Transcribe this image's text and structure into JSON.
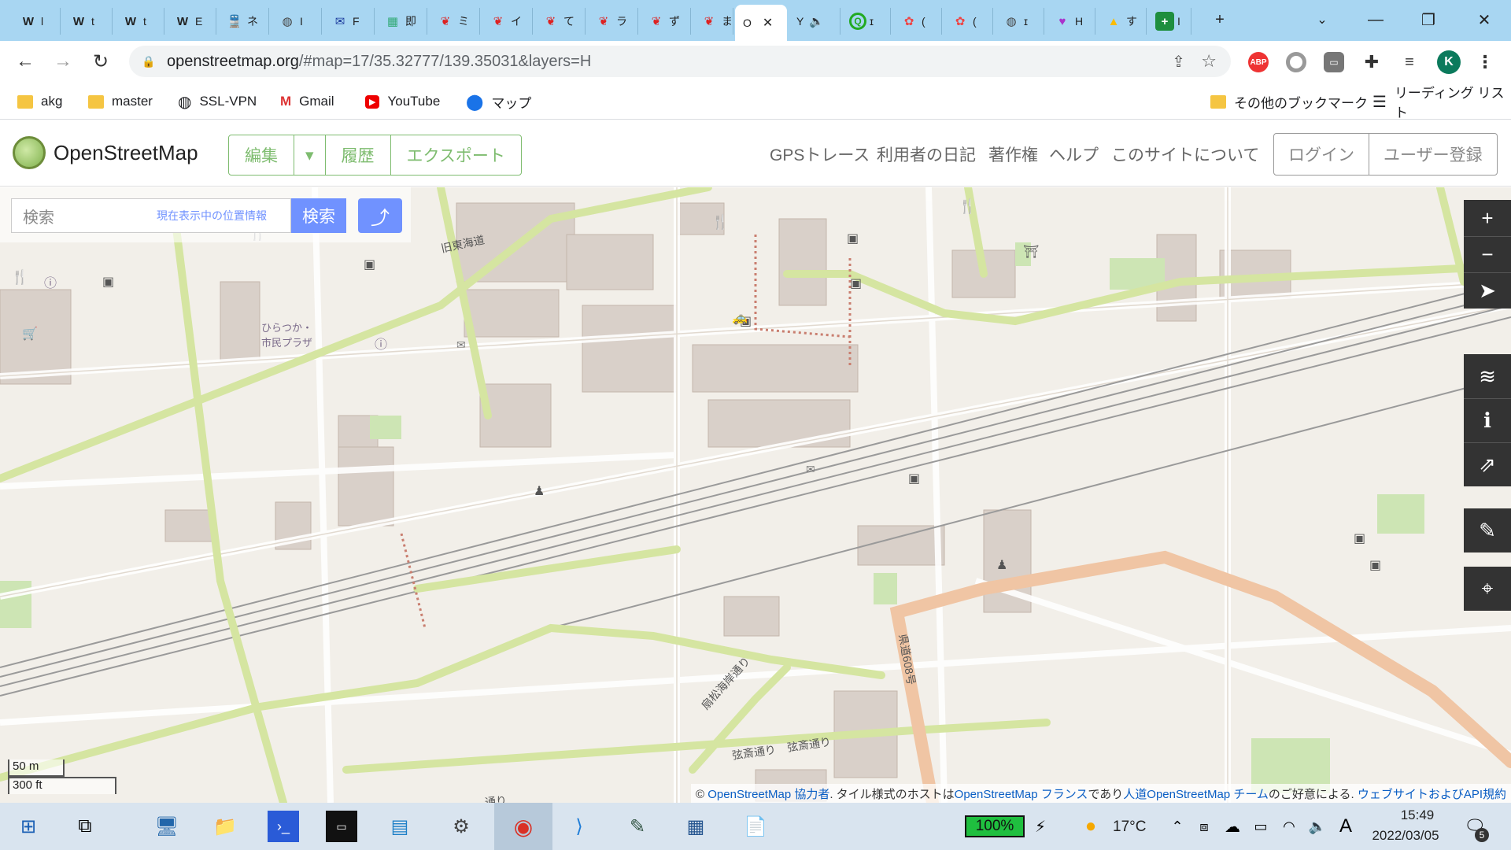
{
  "tabs": [
    {
      "label": "W",
      "title": "l"
    },
    {
      "label": "W",
      "title": "t"
    },
    {
      "label": "W",
      "title": "t"
    },
    {
      "label": "W",
      "title": "E"
    },
    {
      "label": "",
      "title": "ネ"
    },
    {
      "label": "",
      "title": "I"
    },
    {
      "label": "",
      "title": "F"
    },
    {
      "label": "",
      "title": "即"
    },
    {
      "label": "",
      "title": "ミ"
    },
    {
      "label": "",
      "title": "イ"
    },
    {
      "label": "",
      "title": "て"
    },
    {
      "label": "",
      "title": "ラ"
    },
    {
      "label": "",
      "title": "ず"
    },
    {
      "label": "",
      "title": "ま"
    },
    {
      "label": "",
      "title": "O"
    },
    {
      "label": "Y",
      "title": ""
    },
    {
      "label": "",
      "title": "ɪ"
    },
    {
      "label": "",
      "title": "("
    },
    {
      "label": "",
      "title": "("
    },
    {
      "label": "",
      "title": "ɪ"
    },
    {
      "label": "",
      "title": "H"
    },
    {
      "label": "",
      "title": "す"
    },
    {
      "label": "",
      "title": "I"
    }
  ],
  "window": {
    "minimize": "—",
    "restore": "❐",
    "close": "✕",
    "tab_search": "⌄",
    "new_tab": "+"
  },
  "url": {
    "host": "openstreetmap.org",
    "path": "/#map=17/35.32777/139.35031&layers=H"
  },
  "extensions": {
    "abp": "ABP",
    "profile": "K"
  },
  "bookmarks": [
    {
      "label": "akg",
      "icon": "folder-icon"
    },
    {
      "label": "master",
      "icon": "folder-icon"
    },
    {
      "label": "SSL-VPN",
      "icon": "globe-icon"
    },
    {
      "label": "Gmail",
      "icon": "gmail-icon"
    },
    {
      "label": "YouTube",
      "icon": "youtube-icon"
    },
    {
      "label": "マップ",
      "icon": "maps-icon"
    }
  ],
  "bookmarks_right": {
    "other": "その他のブックマーク",
    "reading": "リーディング リスト"
  },
  "osm": {
    "brand": "OpenStreetMap",
    "edit": "編集",
    "history": "履歴",
    "export": "エクスポート",
    "links": [
      "GPSトレース",
      "利用者の日記",
      "著作権",
      "ヘルプ",
      "このサイトについて"
    ],
    "login": "ログイン",
    "signup": "ユーザー登録"
  },
  "search": {
    "placeholder": "検索",
    "where": "現在表示中の位置情報",
    "button": "検索"
  },
  "map_labels": {
    "old_tokaido": "旧東海道",
    "plaza": "ひらつか・市民プラザ",
    "route608": "県道608号",
    "kanmatsu": "扇松海岸通り",
    "genshou1": "弦斎通り",
    "genshou2": "弦斎通り",
    "bottom": "通り"
  },
  "scale": {
    "metric": "50 m",
    "imperial": "300 ft"
  },
  "attribution": {
    "prefix": "© ",
    "link1": "OpenStreetMap 協力者",
    "mid1": ". タイル様式のホストは",
    "link2": "OpenStreetMap フランス",
    "mid2": "であり",
    "link3": "人道OpenStreetMap チーム",
    "mid3": "のご好意による. ",
    "link4": "ウェブサイトおよびAPI規約"
  },
  "taskbar": {
    "battery": "100%",
    "temp": "17°C",
    "ime": "A",
    "time": "15:49",
    "date": "2022/03/05",
    "notifications": "5"
  }
}
